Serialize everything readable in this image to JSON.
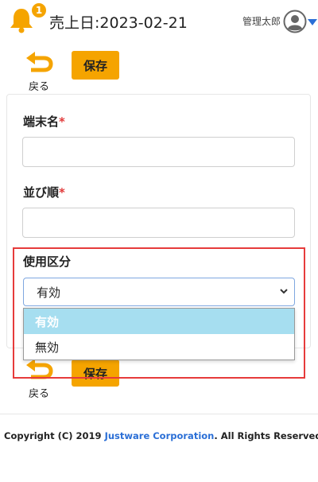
{
  "header": {
    "notification_count": "1",
    "sales_date": "売上日:2023-02-21",
    "user_name": "管理太郎"
  },
  "toolbar": {
    "back_label": "戻る",
    "save_label": "保存"
  },
  "form": {
    "terminal_name_label": "端末名",
    "sort_order_label": "並び順",
    "required_mark": "*",
    "usage_label": "使用区分",
    "usage_selected": "有効",
    "usage_options": [
      "有効",
      "無効"
    ]
  },
  "footer": {
    "prefix": "Copyright (C) 2019 ",
    "company": "Justware Corporation",
    "suffix": ". All Rights Reserved."
  },
  "colors": {
    "accent": "#f5a400",
    "link": "#2b6fd6",
    "highlight": "#e63b3b",
    "dropdown_selected": "#a6def0"
  },
  "icons": [
    "bell-icon",
    "avatar-icon",
    "back-arrow-icon",
    "chevron-down-icon"
  ]
}
